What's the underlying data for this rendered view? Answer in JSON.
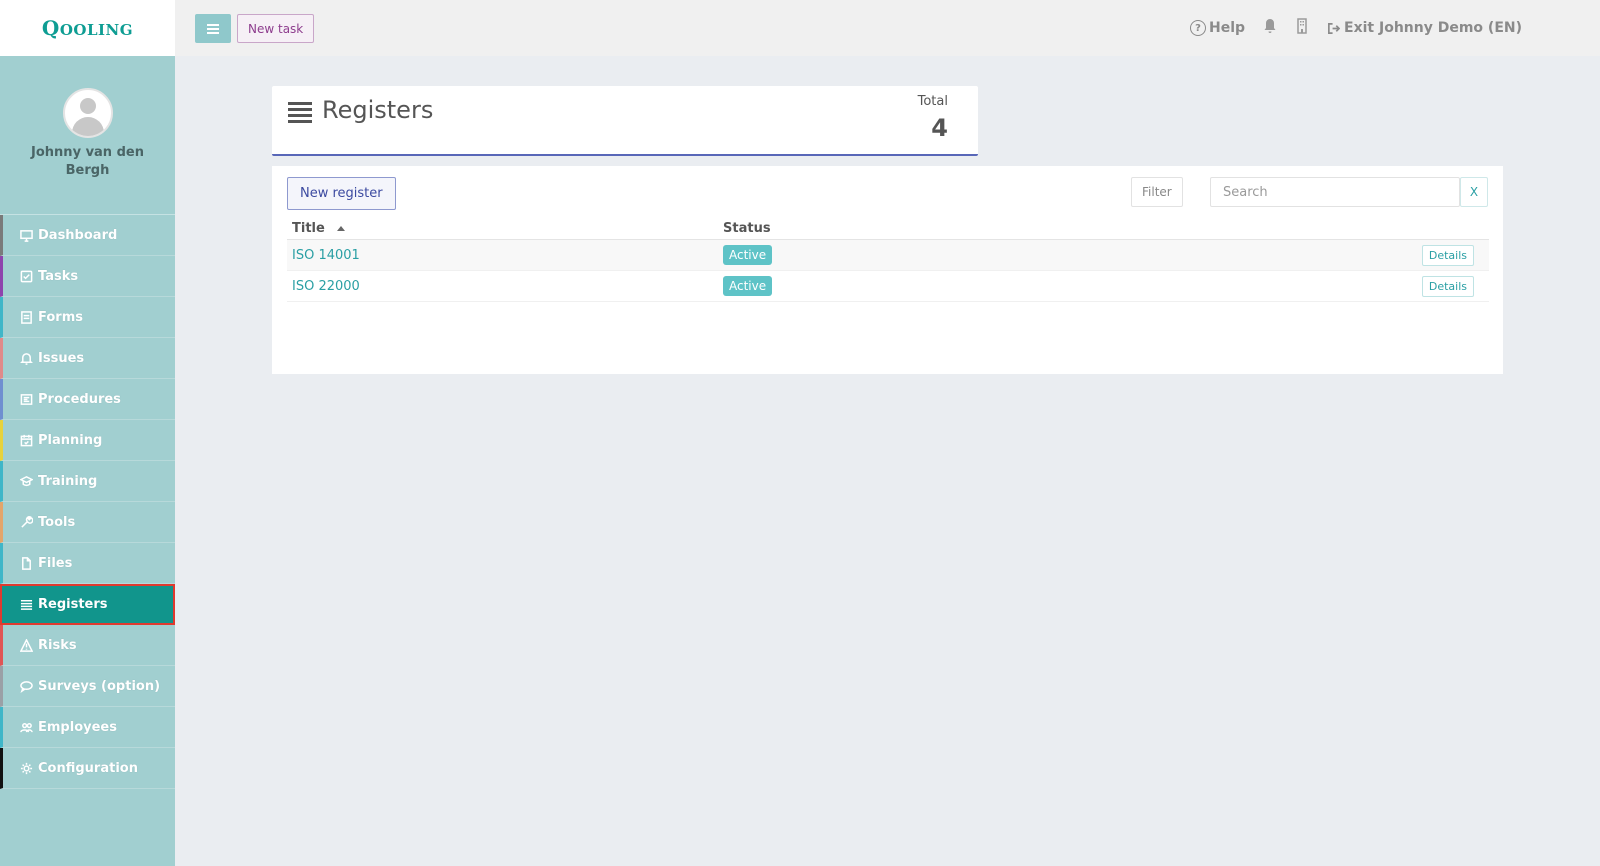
{
  "app": {
    "logo_text": "Qooling"
  },
  "user": {
    "name": "Johnny van den Bergh"
  },
  "sidebar": {
    "items": [
      {
        "label": "Dashboard",
        "icon": "monitor-icon",
        "accent": "#7a7a7a"
      },
      {
        "label": "Tasks",
        "icon": "check-square-icon",
        "accent": "#8e44ad"
      },
      {
        "label": "Forms",
        "icon": "form-icon",
        "accent": "#3fb6c8"
      },
      {
        "label": "Issues",
        "icon": "bell-icon",
        "accent": "#e08a8a"
      },
      {
        "label": "Procedures",
        "icon": "procedure-icon",
        "accent": "#6f8fd0"
      },
      {
        "label": "Planning",
        "icon": "calendar-icon",
        "accent": "#e6d23b"
      },
      {
        "label": "Training",
        "icon": "graduation-cap-icon",
        "accent": "#3fb6c8"
      },
      {
        "label": "Tools",
        "icon": "wrench-icon",
        "accent": "#e3a56b"
      },
      {
        "label": "Files",
        "icon": "file-icon",
        "accent": "#3fb6c8"
      },
      {
        "label": "Registers",
        "icon": "list-icon",
        "accent": "#11958c",
        "active": true
      },
      {
        "label": "Risks",
        "icon": "warning-icon",
        "accent": "#e05555"
      },
      {
        "label": "Surveys (option)",
        "icon": "chat-icon",
        "accent": "#9aa0a6"
      },
      {
        "label": "Employees",
        "icon": "users-icon",
        "accent": "#3fb6c8"
      },
      {
        "label": "Configuration",
        "icon": "gear-icon",
        "accent": "#111111"
      }
    ]
  },
  "topbar": {
    "new_task_label": "New task",
    "help_label": "Help",
    "exit_label": "Exit Johnny Demo (EN)"
  },
  "header": {
    "title": "Registers",
    "total_label": "Total",
    "total_value": "4"
  },
  "content": {
    "new_register_label": "New register",
    "filter_label": "Filter",
    "search_placeholder": "Search",
    "clear_label": "X",
    "columns": {
      "title": "Title",
      "status": "Status"
    },
    "rows": [
      {
        "title": "ISO 14001",
        "status": "Active",
        "action": "Details"
      },
      {
        "title": "ISO 22000",
        "status": "Active",
        "action": "Details"
      }
    ]
  }
}
